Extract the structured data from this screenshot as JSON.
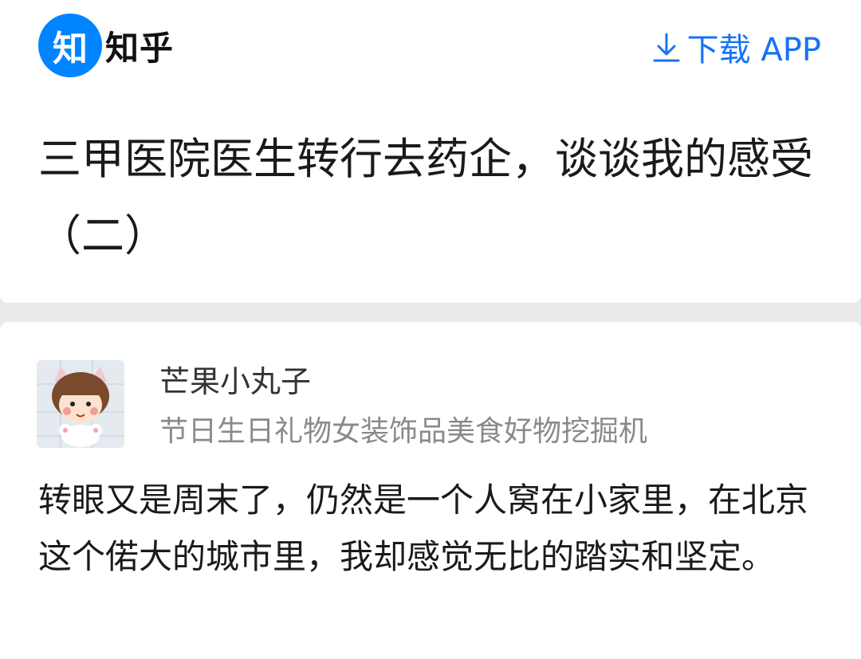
{
  "header": {
    "logo_char": "知",
    "app_name": "知乎",
    "download_label": "下载 APP",
    "accent_color": "#0084ff",
    "download_color": "#1772f6"
  },
  "question": {
    "title": "三甲医院医生转行去药企，谈谈我的感受（二）"
  },
  "answer": {
    "author_name": "芒果小丸子",
    "author_bio": "节日生日礼物女装饰品美食好物挖掘机",
    "content": "转眼又是周末了，仍然是一个人窝在小家里，在北京这个偌大的城市里，我却感觉无比的踏实和坚定。"
  },
  "icons": [
    "download-icon",
    "avatar"
  ]
}
